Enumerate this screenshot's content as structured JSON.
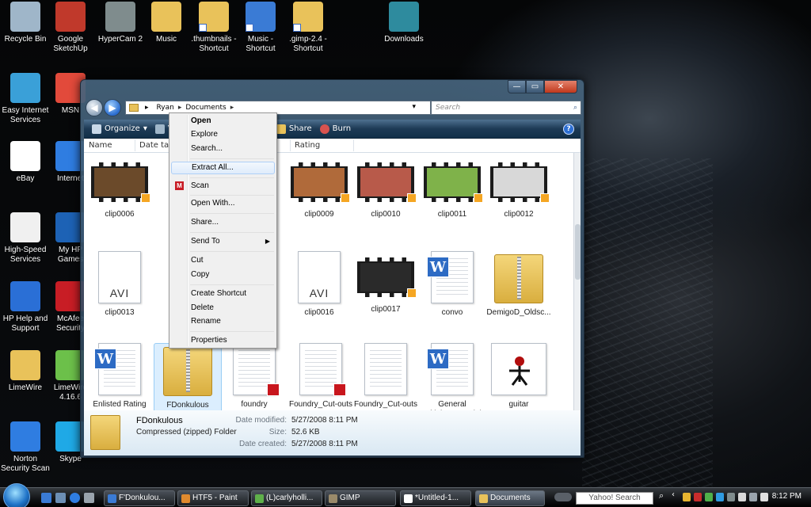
{
  "desktop": {
    "icons": [
      {
        "label": "Recycle Bin",
        "icon": "recycle-bin-icon",
        "color": "#9fb6c9"
      },
      {
        "label": "Google SketchUp",
        "icon": "sketchup-icon",
        "color": "#c0392b"
      },
      {
        "label": "HyperCam 2",
        "icon": "camera-icon",
        "color": "#7f8c8d"
      },
      {
        "label": "Music",
        "icon": "folder-icon",
        "color": "#e9c25a"
      },
      {
        "label": ".thumbnails - Shortcut",
        "icon": "folder-shortcut-icon",
        "color": "#e9c25a"
      },
      {
        "label": "Music - Shortcut",
        "icon": "music-shortcut-icon",
        "color": "#3a7bd5"
      },
      {
        "label": ".gimp-2.4 - Shortcut",
        "icon": "folder-shortcut-icon",
        "color": "#e9c25a"
      },
      {
        "label": "Downloads",
        "icon": "downloads-icon",
        "color": "#2e8b9e"
      },
      {
        "label": "Easy Internet Services",
        "icon": "globe-icon",
        "color": "#3aa0d8"
      },
      {
        "label": "MSN",
        "icon": "msn-icon",
        "color": "#e24a3b"
      },
      {
        "label": "eBay",
        "icon": "ebay-icon",
        "color": "#ffffff"
      },
      {
        "label": "Internet",
        "icon": "internet-explorer-icon",
        "color": "#2f7de1"
      },
      {
        "label": "High-Speed Services",
        "icon": "house-icon",
        "color": "#f0f0f0"
      },
      {
        "label": "My HP Games",
        "icon": "hp-games-icon",
        "color": "#1d62b5"
      },
      {
        "label": "HP Help and Support",
        "icon": "help-icon",
        "color": "#2a6fd6"
      },
      {
        "label": "McAfee Security",
        "icon": "mcafee-icon",
        "color": "#c81d25"
      },
      {
        "label": "LimeWire",
        "icon": "folder-icon",
        "color": "#e9c25a"
      },
      {
        "label": "LimeWire 4.16.6",
        "icon": "limewire-icon",
        "color": "#6cc04a"
      },
      {
        "label": "Norton Security Scan",
        "icon": "norton-icon",
        "color": "#2f7de1"
      },
      {
        "label": "Skype",
        "icon": "skype-icon",
        "color": "#1fa9e6"
      }
    ]
  },
  "window": {
    "breadcrumb": [
      "Ryan",
      "Documents"
    ],
    "search_placeholder": "Search",
    "toolbar": {
      "organize": "Organize",
      "views": "Vi",
      "email": "il",
      "share": "Share",
      "burn": "Burn"
    },
    "columns": {
      "name": "Name",
      "date": "Date take",
      "rating": "Rating"
    },
    "files": [
      {
        "name": "clip0006",
        "kind": "video",
        "tint": "#6b4a2a"
      },
      {
        "name": "clip0009",
        "kind": "video",
        "tint": "#b06a3a"
      },
      {
        "name": "clip0010",
        "kind": "video",
        "tint": "#b85a4a"
      },
      {
        "name": "clip0011",
        "kind": "video",
        "tint": "#7fb24a"
      },
      {
        "name": "clip0012",
        "kind": "video",
        "tint": "#d8d8d8"
      },
      {
        "name": "clip0013",
        "kind": "avi",
        "avi": "AVI"
      },
      {
        "name": "clip0016",
        "kind": "avi",
        "avi": "AVI"
      },
      {
        "name": "clip0017",
        "kind": "video",
        "tint": "#2a2a2a"
      },
      {
        "name": "convo",
        "kind": "word"
      },
      {
        "name": "DemigoD_Oldsc...",
        "kind": "zip"
      },
      {
        "name": "Enlisted Rating",
        "kind": "word"
      },
      {
        "name": "FDonkulous",
        "kind": "zip"
      },
      {
        "name": "foundry",
        "kind": "pdf"
      },
      {
        "name": "Foundry_Cut-outs",
        "kind": "pdf"
      },
      {
        "name": "Foundry_Cut-outs",
        "kind": "blank"
      },
      {
        "name": "General Multiplayer Medals",
        "kind": "word"
      },
      {
        "name": "guitar",
        "kind": "image"
      }
    ],
    "details": {
      "name": "FDonkulous",
      "type": "Compressed (zipped) Folder",
      "modified_label": "Date modified:",
      "modified": "5/27/2008 8:11 PM",
      "size_label": "Size:",
      "size": "52.6 KB",
      "created_label": "Date created:",
      "created": "5/27/2008 8:11 PM"
    }
  },
  "context_menu": {
    "open": "Open",
    "explore": "Explore",
    "search": "Search...",
    "extract_all": "Extract All...",
    "scan": "Scan",
    "open_with": "Open With...",
    "share": "Share...",
    "send_to": "Send To",
    "cut": "Cut",
    "copy": "Copy",
    "create_shortcut": "Create Shortcut",
    "delete": "Delete",
    "rename": "Rename",
    "properties": "Properties"
  },
  "taskbar": {
    "buttons": [
      {
        "label": "F'Donkulou...",
        "icon_color": "#3a7bd5"
      },
      {
        "label": "HTF5 - Paint",
        "icon_color": "#e08a2e"
      },
      {
        "label": "(L)carlyholli...",
        "icon_color": "#5fb04a"
      },
      {
        "label": "GIMP",
        "icon_color": "#9a8a6a"
      },
      {
        "label": "*Untitled-1...",
        "icon_color": "#ffffff"
      },
      {
        "label": "Documents",
        "icon_color": "#e9c25a"
      }
    ],
    "search_text": "Yahoo! Search",
    "clock": "8:12 PM"
  }
}
